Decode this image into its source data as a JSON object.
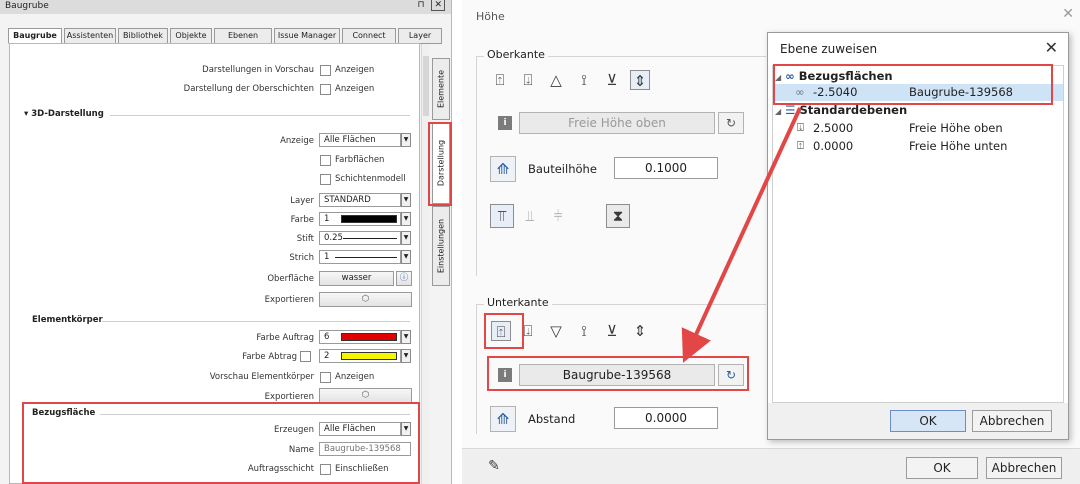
{
  "left_panel": {
    "title": "Baugrube",
    "controls": [
      "⊓",
      "✕"
    ],
    "tabs": [
      "Baugrube",
      "Assistenten",
      "Bibliothek",
      "Objekte",
      "Ebenen",
      "Issue Manager",
      "Connect",
      "Layer"
    ],
    "side_tabs": [
      "Elemente",
      "Darstellung",
      "Einstellungen"
    ],
    "rows": {
      "vorschau": "Darstellungen in Vorschau",
      "oberschichten": "Darstellung der Oberschichten",
      "anzeigen": "Anzeigen",
      "anzeige": "Anzeige",
      "layer": "Layer",
      "farbe": "Farbe",
      "stift": "Stift",
      "strich": "Strich",
      "oberflaeche": "Oberfläche",
      "exportieren": "Exportieren",
      "farbe_auftrag": "Farbe Auftrag",
      "farbe_abtrag": "Farbe Abtrag",
      "vorschau_elementkoerper": "Vorschau Elementkörper",
      "erzeugen": "Erzeugen",
      "name": "Name",
      "auftragsschicht": "Auftragsschicht"
    },
    "sections": {
      "darstellung_3d": "3D-Darstellung",
      "elementkoerper": "Elementkörper",
      "bezugsflaeche": "Bezugsfläche"
    },
    "values": {
      "anzeige": "Alle Flächen",
      "farbflaechen": "Farbflächen",
      "schichtenmodell": "Schichtenmodell",
      "layer": "STANDARD",
      "farbe": "1",
      "stift": "0.25",
      "strich": "1",
      "oberflaeche": "wasser",
      "farbe_auftrag": "6",
      "farbe_abtrag": "2",
      "erzeugen": "Alle Flächen",
      "name_placeholder": "Baugrube-139568",
      "einschliessen": "Einschließen"
    },
    "colors": {
      "farbe": "#000000",
      "farbe_auftrag": "#e00000",
      "farbe_abtrag": "#f5f500"
    }
  },
  "hoehe_dialog": {
    "title": "Höhe",
    "oberkante_label": "Oberkante",
    "freie_hoehe_oben": "Freie Höhe oben",
    "bauteilhoehe_label": "Bauteilhöhe",
    "bauteilhoehe_value": "0.1000",
    "unterkante_label": "Unterkante",
    "unterkante_value": "Baugrube-139568",
    "abstand_label": "Abstand",
    "abstand_value": "0.0000",
    "ok": "OK",
    "cancel": "Abbrechen"
  },
  "ebene_dialog": {
    "title": "Ebene zuweisen",
    "groups": [
      {
        "name": "Bezugsflächen",
        "items": [
          {
            "value": "-2.5040",
            "label": "Baugrube-139568"
          }
        ]
      },
      {
        "name": "Standardebenen",
        "items": [
          {
            "value": "2.5000",
            "label": "Freie Höhe oben"
          },
          {
            "value": "0.0000",
            "label": "Freie Höhe unten"
          }
        ]
      }
    ],
    "ok": "OK",
    "cancel": "Abbrechen"
  }
}
